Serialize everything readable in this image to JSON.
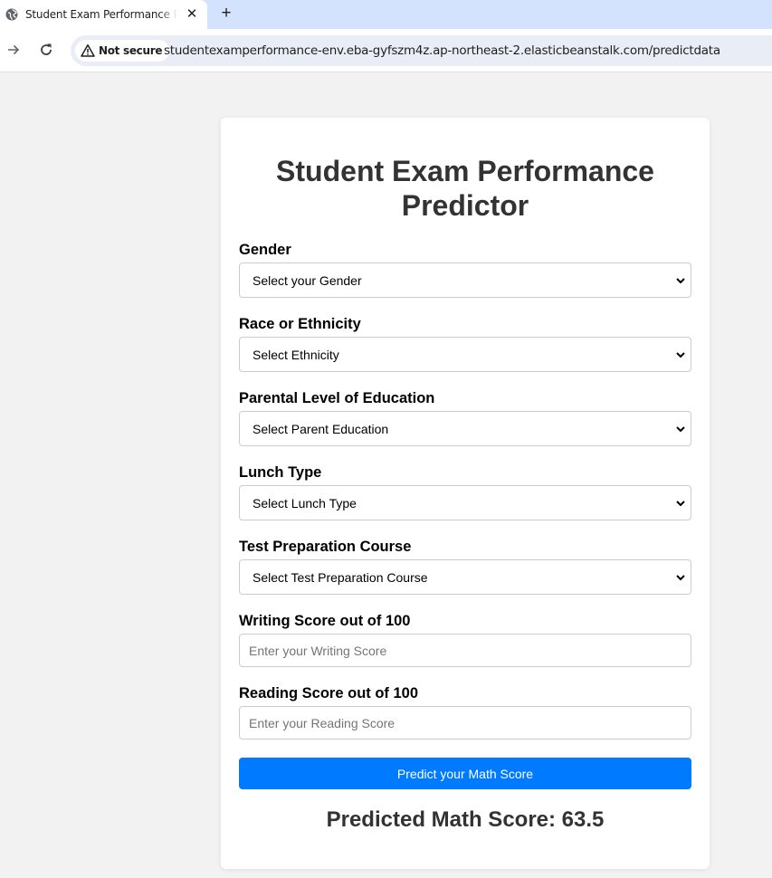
{
  "browser": {
    "tab_title": "Student Exam Performance Predictor",
    "tab_close": "✕",
    "new_tab": "+",
    "security_label": "Not secure",
    "url": "studentexamperformance-env.eba-gyfszm4z.ap-northeast-2.elasticbeanstalk.com/predictdata"
  },
  "form": {
    "title": "Student Exam Performance Predictor",
    "fields": [
      {
        "label": "Gender",
        "type": "select",
        "value": "Select your Gender"
      },
      {
        "label": "Race or Ethnicity",
        "type": "select",
        "value": "Select Ethnicity"
      },
      {
        "label": "Parental Level of Education",
        "type": "select",
        "value": "Select Parent Education"
      },
      {
        "label": "Lunch Type",
        "type": "select",
        "value": "Select Lunch Type"
      },
      {
        "label": "Test Preparation Course",
        "type": "select",
        "value": "Select Test Preparation Course"
      },
      {
        "label": "Writing Score out of 100",
        "type": "input",
        "placeholder": "Enter your Writing Score"
      },
      {
        "label": "Reading Score out of 100",
        "type": "input",
        "placeholder": "Enter your Reading Score"
      }
    ],
    "submit_label": "Predict your Math Score",
    "result_text": "Predicted Math Score: 63.5"
  },
  "colors": {
    "button": "#007bff",
    "page_background": "#f2f2f2",
    "tab_strip": "#d3e3fd"
  },
  "icons": [
    "globe-icon",
    "close-icon",
    "plus-icon",
    "forward-arrow-icon",
    "reload-icon",
    "warning-icon",
    "chevron-down-icon"
  ]
}
